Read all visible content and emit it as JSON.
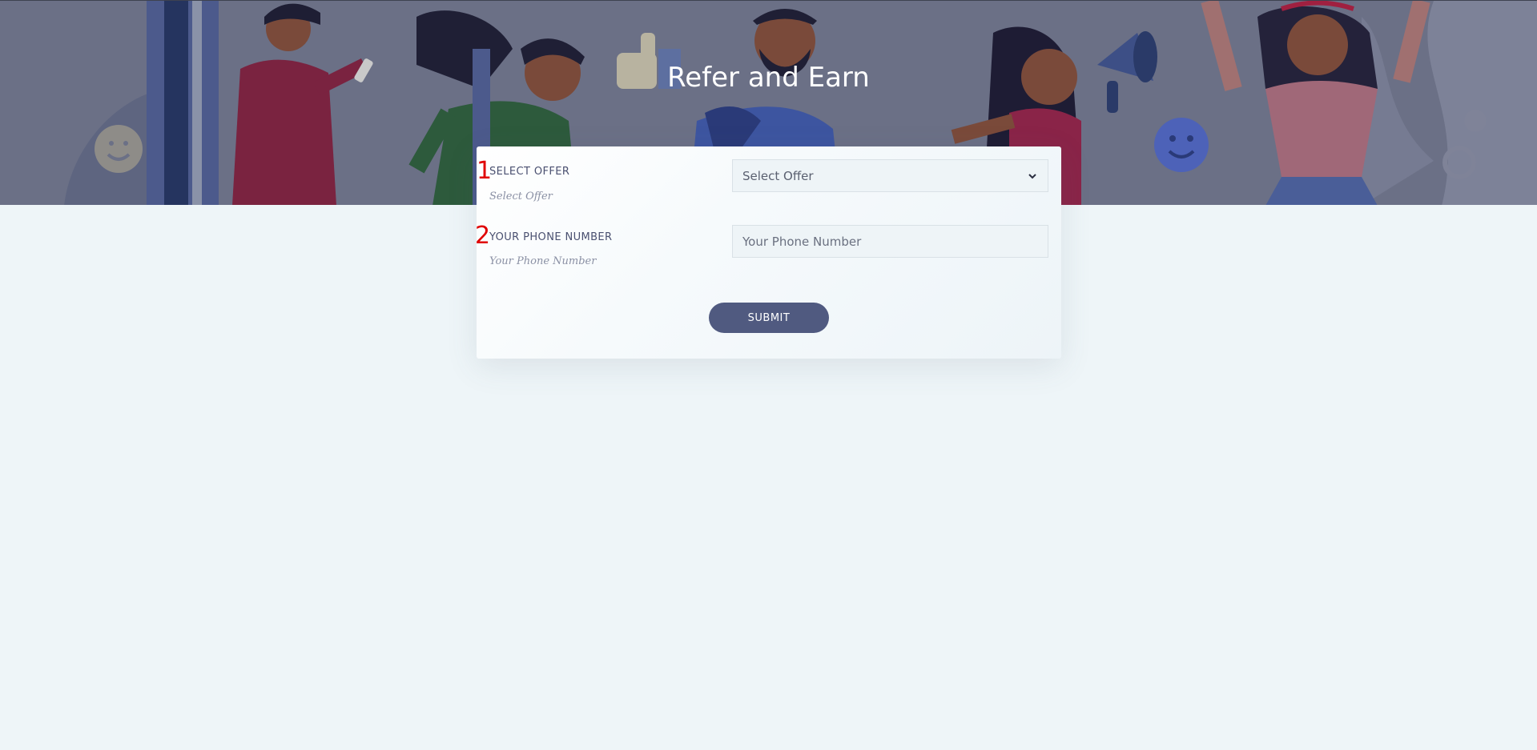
{
  "hero": {
    "title": "Refer and Earn"
  },
  "form": {
    "fields": [
      {
        "marker": "1",
        "label": "SELECT OFFER",
        "hint": "Select Offer",
        "control_type": "select",
        "selected_value": "Select Offer"
      },
      {
        "marker": "2",
        "label": "YOUR PHONE NUMBER",
        "hint": "Your Phone Number",
        "control_type": "text",
        "value": "",
        "placeholder": "Your Phone Number"
      }
    ],
    "submit_label": "SUBMIT"
  },
  "icons": {
    "select_chevron": "chevron-down-icon"
  },
  "colors": {
    "page_background": "#eef5f8",
    "hero_overlay": "#6b7086",
    "button": "#505a80",
    "marker": "#e00000"
  }
}
